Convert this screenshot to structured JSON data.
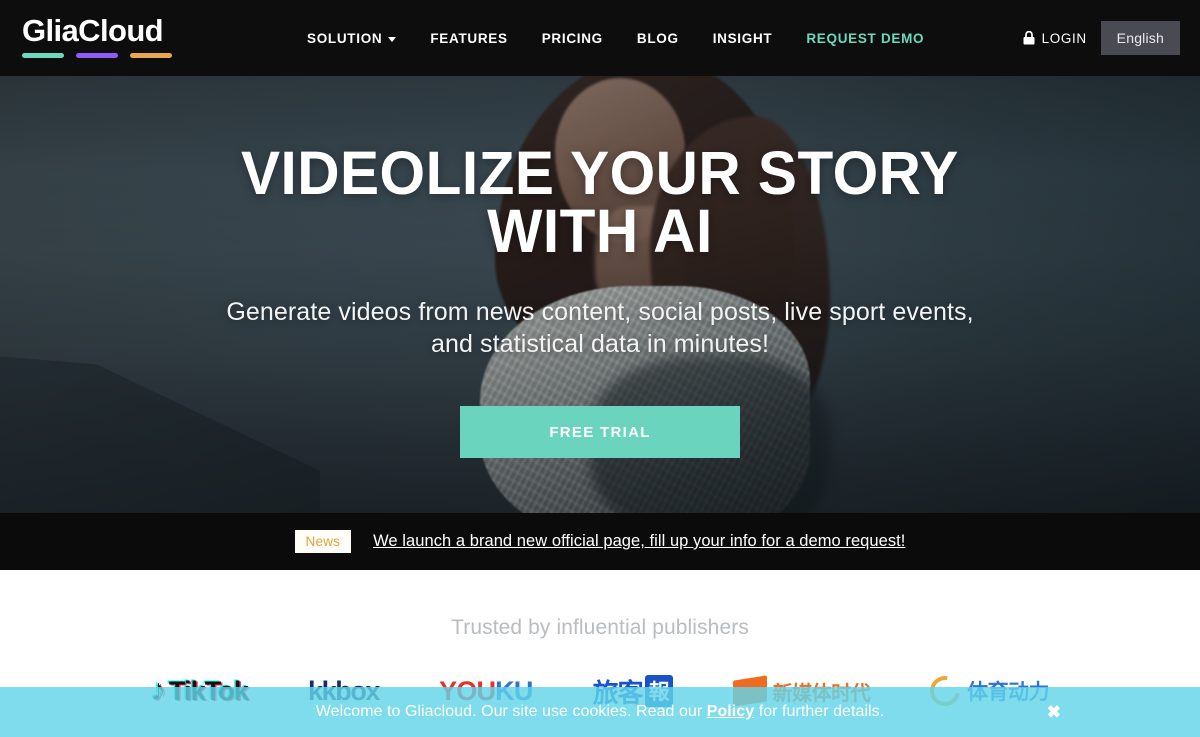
{
  "header": {
    "logo": {
      "text": "GliaCloud",
      "bar_colors": [
        "#6BD9BC",
        "#8B5CF6",
        "#E8A94E"
      ]
    },
    "nav": [
      {
        "label": "SOLUTION",
        "has_caret": true,
        "accent": false
      },
      {
        "label": "FEATURES",
        "has_caret": false,
        "accent": false
      },
      {
        "label": "PRICING",
        "has_caret": false,
        "accent": false
      },
      {
        "label": "BLOG",
        "has_caret": false,
        "accent": false
      },
      {
        "label": "INSIGHT",
        "has_caret": false,
        "accent": false
      },
      {
        "label": "REQUEST DEMO",
        "has_caret": false,
        "accent": true
      }
    ],
    "login_label": "LOGIN",
    "login_icon": "lock-icon",
    "language_label": "English",
    "accent_color": "#6BD9BC",
    "background_color": "#0d0d0d"
  },
  "hero": {
    "title_line1": "VIDEOLIZE YOUR STORY",
    "title_line2": "WITH AI",
    "subtitle_line1": "Generate videos from news content, social posts, live sport events,",
    "subtitle_line2": "and statistical data in minutes!",
    "cta_label": "FREE TRIAL",
    "cta_color": "#6BD4BF"
  },
  "news_bar": {
    "badge": "News",
    "badge_color": "#E0A33C",
    "message": "We launch a brand new official page, fill up your info for a demo request!"
  },
  "publishers": {
    "title": "Trusted by influential publishers",
    "logos": [
      {
        "name": "tiktok",
        "text": "TikTok"
      },
      {
        "name": "kkbox",
        "text": "kkbox"
      },
      {
        "name": "youku",
        "text_red": "YOU",
        "text_blue": "KU"
      },
      {
        "name": "hotel-news",
        "text": "旅客",
        "badge": "報"
      },
      {
        "name": "orange-media",
        "text": "新媒体时代"
      },
      {
        "name": "sports-power",
        "text": "体育动力"
      }
    ]
  },
  "cookie_banner": {
    "text_before": "Welcome to Gliacloud. Our site use cookies. Read our ",
    "policy_label": "Policy",
    "text_after": " for further details.",
    "close_icon": "close-icon",
    "background_color": "#62D4E8"
  }
}
